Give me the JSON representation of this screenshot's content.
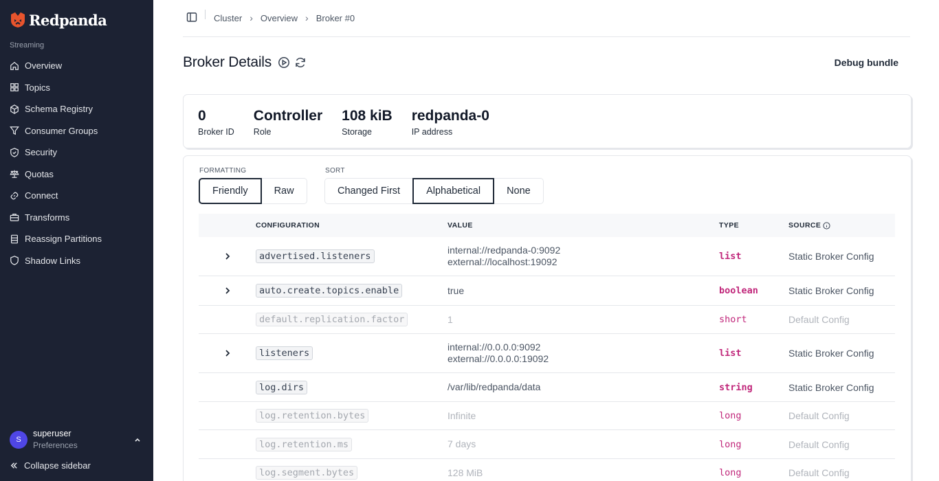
{
  "sidebar": {
    "logo_text": "Redpanda",
    "section_label": "Streaming",
    "items": [
      {
        "label": "Overview",
        "icon": "home-icon"
      },
      {
        "label": "Topics",
        "icon": "grid-icon"
      },
      {
        "label": "Schema Registry",
        "icon": "cube-icon"
      },
      {
        "label": "Consumer Groups",
        "icon": "filter-icon"
      },
      {
        "label": "Security",
        "icon": "shield-check-icon"
      },
      {
        "label": "Quotas",
        "icon": "scale-icon"
      },
      {
        "label": "Connect",
        "icon": "link-icon"
      },
      {
        "label": "Transforms",
        "icon": "briefcase-icon"
      },
      {
        "label": "Reassign Partitions",
        "icon": "stack-icon"
      },
      {
        "label": "Shadow Links",
        "icon": "shield-icon"
      }
    ],
    "user": {
      "initial": "S",
      "name": "superuser",
      "sub": "Preferences"
    },
    "collapse_label": "Collapse sidebar"
  },
  "breadcrumb": [
    "Cluster",
    "Overview",
    "Broker #0"
  ],
  "page": {
    "title": "Broker Details",
    "debug_label": "Debug bundle"
  },
  "stats": [
    {
      "value": "0",
      "label": "Broker ID"
    },
    {
      "value": "Controller",
      "label": "Role"
    },
    {
      "value": "108 kiB",
      "label": "Storage"
    },
    {
      "value": "redpanda-0",
      "label": "IP address"
    }
  ],
  "formatting": {
    "label": "FORMATTING",
    "options": [
      "Friendly",
      "Raw"
    ],
    "selected": "Friendly"
  },
  "sort": {
    "label": "SORT",
    "options": [
      "Changed First",
      "Alphabetical",
      "None"
    ],
    "selected": "Alphabetical"
  },
  "table": {
    "headers": {
      "config": "CONFIGURATION",
      "value": "VALUE",
      "type": "TYPE",
      "source": "SOURCE"
    },
    "rows": [
      {
        "name": "advertised.listeners",
        "value": [
          "internal://redpanda-0:9092",
          "external://localhost:19092"
        ],
        "type": "list",
        "source": "Static Broker Config",
        "expandable": true,
        "dim": false
      },
      {
        "name": "auto.create.topics.enable",
        "value": [
          "true"
        ],
        "type": "boolean",
        "source": "Static Broker Config",
        "expandable": true,
        "dim": false
      },
      {
        "name": "default.replication.factor",
        "value": [
          "1"
        ],
        "type": "short",
        "source": "Default Config",
        "expandable": false,
        "dim": true
      },
      {
        "name": "listeners",
        "value": [
          "internal://0.0.0.0:9092",
          "external://0.0.0.0:19092"
        ],
        "type": "list",
        "source": "Static Broker Config",
        "expandable": true,
        "dim": false
      },
      {
        "name": "log.dirs",
        "value": [
          "/var/lib/redpanda/data"
        ],
        "type": "string",
        "source": "Static Broker Config",
        "expandable": false,
        "dim": false
      },
      {
        "name": "log.retention.bytes",
        "value": [
          "Infinite"
        ],
        "type": "long",
        "source": "Default Config",
        "expandable": false,
        "dim": true
      },
      {
        "name": "log.retention.ms",
        "value": [
          "7 days"
        ],
        "type": "long",
        "source": "Default Config",
        "expandable": false,
        "dim": true
      },
      {
        "name": "log.segment.bytes",
        "value": [
          "128 MiB"
        ],
        "type": "long",
        "source": "Default Config",
        "expandable": false,
        "dim": true
      }
    ]
  },
  "colors": {
    "sidebar_bg": "#1c2233",
    "brand": "#e8542d",
    "type_accent": "#c0267a"
  }
}
